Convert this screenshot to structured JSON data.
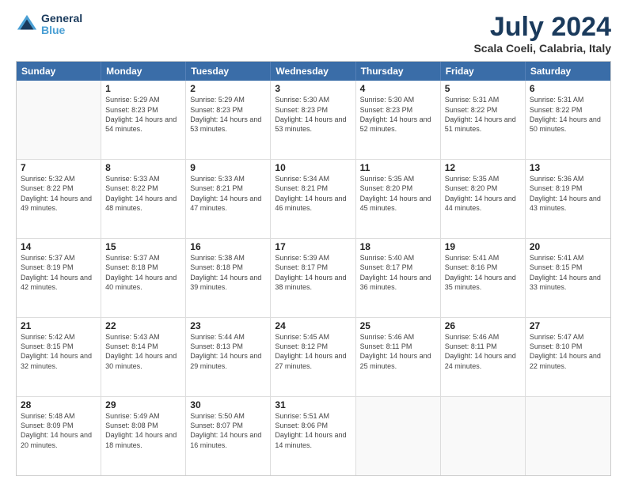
{
  "header": {
    "logo_line1": "General",
    "logo_line2": "Blue",
    "title": "July 2024",
    "subtitle": "Scala Coeli, Calabria, Italy"
  },
  "calendar": {
    "days": [
      "Sunday",
      "Monday",
      "Tuesday",
      "Wednesday",
      "Thursday",
      "Friday",
      "Saturday"
    ],
    "weeks": [
      [
        {
          "day": "",
          "sunrise": "",
          "sunset": "",
          "daylight": ""
        },
        {
          "day": "1",
          "sunrise": "Sunrise: 5:29 AM",
          "sunset": "Sunset: 8:23 PM",
          "daylight": "Daylight: 14 hours and 54 minutes."
        },
        {
          "day": "2",
          "sunrise": "Sunrise: 5:29 AM",
          "sunset": "Sunset: 8:23 PM",
          "daylight": "Daylight: 14 hours and 53 minutes."
        },
        {
          "day": "3",
          "sunrise": "Sunrise: 5:30 AM",
          "sunset": "Sunset: 8:23 PM",
          "daylight": "Daylight: 14 hours and 53 minutes."
        },
        {
          "day": "4",
          "sunrise": "Sunrise: 5:30 AM",
          "sunset": "Sunset: 8:23 PM",
          "daylight": "Daylight: 14 hours and 52 minutes."
        },
        {
          "day": "5",
          "sunrise": "Sunrise: 5:31 AM",
          "sunset": "Sunset: 8:22 PM",
          "daylight": "Daylight: 14 hours and 51 minutes."
        },
        {
          "day": "6",
          "sunrise": "Sunrise: 5:31 AM",
          "sunset": "Sunset: 8:22 PM",
          "daylight": "Daylight: 14 hours and 50 minutes."
        }
      ],
      [
        {
          "day": "7",
          "sunrise": "Sunrise: 5:32 AM",
          "sunset": "Sunset: 8:22 PM",
          "daylight": "Daylight: 14 hours and 49 minutes."
        },
        {
          "day": "8",
          "sunrise": "Sunrise: 5:33 AM",
          "sunset": "Sunset: 8:22 PM",
          "daylight": "Daylight: 14 hours and 48 minutes."
        },
        {
          "day": "9",
          "sunrise": "Sunrise: 5:33 AM",
          "sunset": "Sunset: 8:21 PM",
          "daylight": "Daylight: 14 hours and 47 minutes."
        },
        {
          "day": "10",
          "sunrise": "Sunrise: 5:34 AM",
          "sunset": "Sunset: 8:21 PM",
          "daylight": "Daylight: 14 hours and 46 minutes."
        },
        {
          "day": "11",
          "sunrise": "Sunrise: 5:35 AM",
          "sunset": "Sunset: 8:20 PM",
          "daylight": "Daylight: 14 hours and 45 minutes."
        },
        {
          "day": "12",
          "sunrise": "Sunrise: 5:35 AM",
          "sunset": "Sunset: 8:20 PM",
          "daylight": "Daylight: 14 hours and 44 minutes."
        },
        {
          "day": "13",
          "sunrise": "Sunrise: 5:36 AM",
          "sunset": "Sunset: 8:19 PM",
          "daylight": "Daylight: 14 hours and 43 minutes."
        }
      ],
      [
        {
          "day": "14",
          "sunrise": "Sunrise: 5:37 AM",
          "sunset": "Sunset: 8:19 PM",
          "daylight": "Daylight: 14 hours and 42 minutes."
        },
        {
          "day": "15",
          "sunrise": "Sunrise: 5:37 AM",
          "sunset": "Sunset: 8:18 PM",
          "daylight": "Daylight: 14 hours and 40 minutes."
        },
        {
          "day": "16",
          "sunrise": "Sunrise: 5:38 AM",
          "sunset": "Sunset: 8:18 PM",
          "daylight": "Daylight: 14 hours and 39 minutes."
        },
        {
          "day": "17",
          "sunrise": "Sunrise: 5:39 AM",
          "sunset": "Sunset: 8:17 PM",
          "daylight": "Daylight: 14 hours and 38 minutes."
        },
        {
          "day": "18",
          "sunrise": "Sunrise: 5:40 AM",
          "sunset": "Sunset: 8:17 PM",
          "daylight": "Daylight: 14 hours and 36 minutes."
        },
        {
          "day": "19",
          "sunrise": "Sunrise: 5:41 AM",
          "sunset": "Sunset: 8:16 PM",
          "daylight": "Daylight: 14 hours and 35 minutes."
        },
        {
          "day": "20",
          "sunrise": "Sunrise: 5:41 AM",
          "sunset": "Sunset: 8:15 PM",
          "daylight": "Daylight: 14 hours and 33 minutes."
        }
      ],
      [
        {
          "day": "21",
          "sunrise": "Sunrise: 5:42 AM",
          "sunset": "Sunset: 8:15 PM",
          "daylight": "Daylight: 14 hours and 32 minutes."
        },
        {
          "day": "22",
          "sunrise": "Sunrise: 5:43 AM",
          "sunset": "Sunset: 8:14 PM",
          "daylight": "Daylight: 14 hours and 30 minutes."
        },
        {
          "day": "23",
          "sunrise": "Sunrise: 5:44 AM",
          "sunset": "Sunset: 8:13 PM",
          "daylight": "Daylight: 14 hours and 29 minutes."
        },
        {
          "day": "24",
          "sunrise": "Sunrise: 5:45 AM",
          "sunset": "Sunset: 8:12 PM",
          "daylight": "Daylight: 14 hours and 27 minutes."
        },
        {
          "day": "25",
          "sunrise": "Sunrise: 5:46 AM",
          "sunset": "Sunset: 8:11 PM",
          "daylight": "Daylight: 14 hours and 25 minutes."
        },
        {
          "day": "26",
          "sunrise": "Sunrise: 5:46 AM",
          "sunset": "Sunset: 8:11 PM",
          "daylight": "Daylight: 14 hours and 24 minutes."
        },
        {
          "day": "27",
          "sunrise": "Sunrise: 5:47 AM",
          "sunset": "Sunset: 8:10 PM",
          "daylight": "Daylight: 14 hours and 22 minutes."
        }
      ],
      [
        {
          "day": "28",
          "sunrise": "Sunrise: 5:48 AM",
          "sunset": "Sunset: 8:09 PM",
          "daylight": "Daylight: 14 hours and 20 minutes."
        },
        {
          "day": "29",
          "sunrise": "Sunrise: 5:49 AM",
          "sunset": "Sunset: 8:08 PM",
          "daylight": "Daylight: 14 hours and 18 minutes."
        },
        {
          "day": "30",
          "sunrise": "Sunrise: 5:50 AM",
          "sunset": "Sunset: 8:07 PM",
          "daylight": "Daylight: 14 hours and 16 minutes."
        },
        {
          "day": "31",
          "sunrise": "Sunrise: 5:51 AM",
          "sunset": "Sunset: 8:06 PM",
          "daylight": "Daylight: 14 hours and 14 minutes."
        },
        {
          "day": "",
          "sunrise": "",
          "sunset": "",
          "daylight": ""
        },
        {
          "day": "",
          "sunrise": "",
          "sunset": "",
          "daylight": ""
        },
        {
          "day": "",
          "sunrise": "",
          "sunset": "",
          "daylight": ""
        }
      ]
    ]
  }
}
